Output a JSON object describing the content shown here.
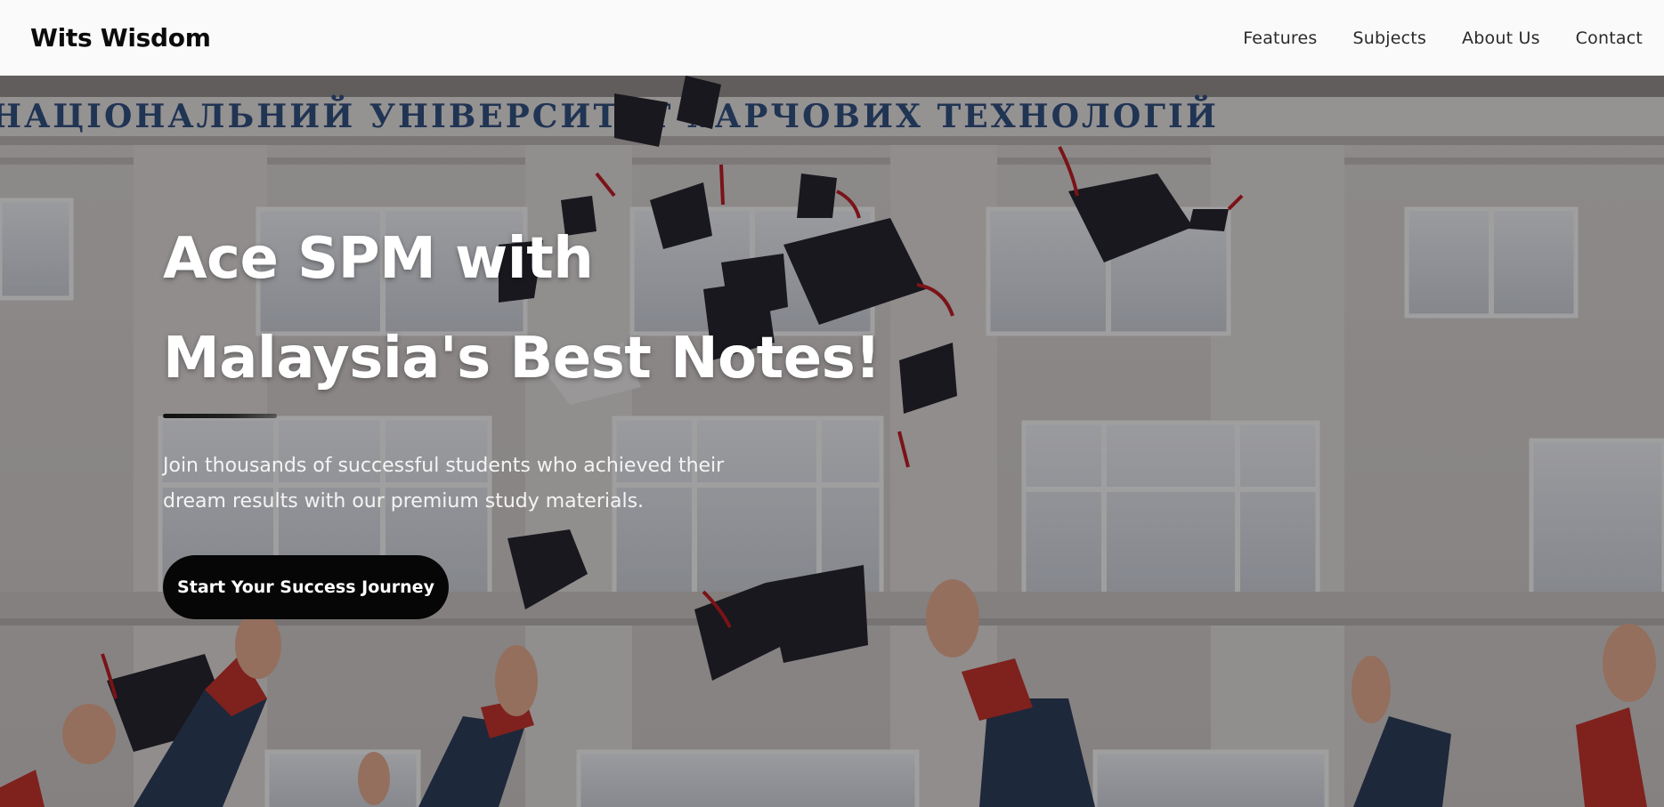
{
  "nav": {
    "brand": "Wits Wisdom",
    "links": [
      {
        "label": "Features"
      },
      {
        "label": "Subjects"
      },
      {
        "label": "About Us"
      },
      {
        "label": "Contact"
      }
    ]
  },
  "hero": {
    "title_line1": "Ace SPM with",
    "title_line2": "Malaysia's Best Notes!",
    "subtitle": "Join thousands of successful students who achieved their dream results with our premium study materials.",
    "cta_label": "Start Your Success Journey",
    "image_description_icon": "graduation-caps-thrown-photo",
    "building_sign": "НАЦІОНАЛЬНИЙ УНІВЕРСИТЕТ ХАРЧОВИХ ТЕХНОЛОГІЙ"
  }
}
